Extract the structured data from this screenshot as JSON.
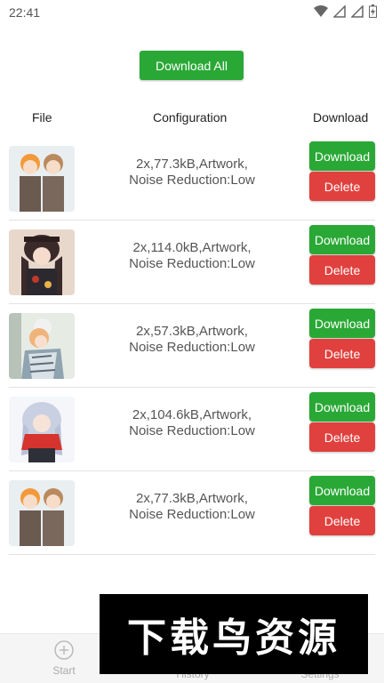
{
  "status_bar": {
    "time": "22:41"
  },
  "actions": {
    "download_all": "Download All"
  },
  "table": {
    "headers": {
      "file": "File",
      "configuration": "Configuration",
      "download": "Download"
    },
    "rows": [
      {
        "line1": "2x,77.3kB,Artwork,",
        "line2": "Noise Reduction:Low",
        "download": "Download",
        "delete": "Delete"
      },
      {
        "line1": "2x,114.0kB,Artwork,",
        "line2": "Noise Reduction:Low",
        "download": "Download",
        "delete": "Delete"
      },
      {
        "line1": "2x,57.3kB,Artwork,",
        "line2": "Noise Reduction:Low",
        "download": "Download",
        "delete": "Delete"
      },
      {
        "line1": "2x,104.6kB,Artwork,",
        "line2": "Noise Reduction:Low",
        "download": "Download",
        "delete": "Delete"
      },
      {
        "line1": "2x,77.3kB,Artwork,",
        "line2": "Noise Reduction:Low",
        "download": "Download",
        "delete": "Delete"
      }
    ]
  },
  "bottom_nav": {
    "start": "Start",
    "history": "History",
    "settings": "Settings"
  },
  "watermark": {
    "text": "下载鸟资源"
  },
  "colors": {
    "green": "#2aa836",
    "red": "#e0413e"
  },
  "icons": {
    "status": [
      "wifi-icon",
      "signal-icon",
      "signal-icon",
      "battery-icon"
    ],
    "nav_start": "plus-circle-icon"
  }
}
